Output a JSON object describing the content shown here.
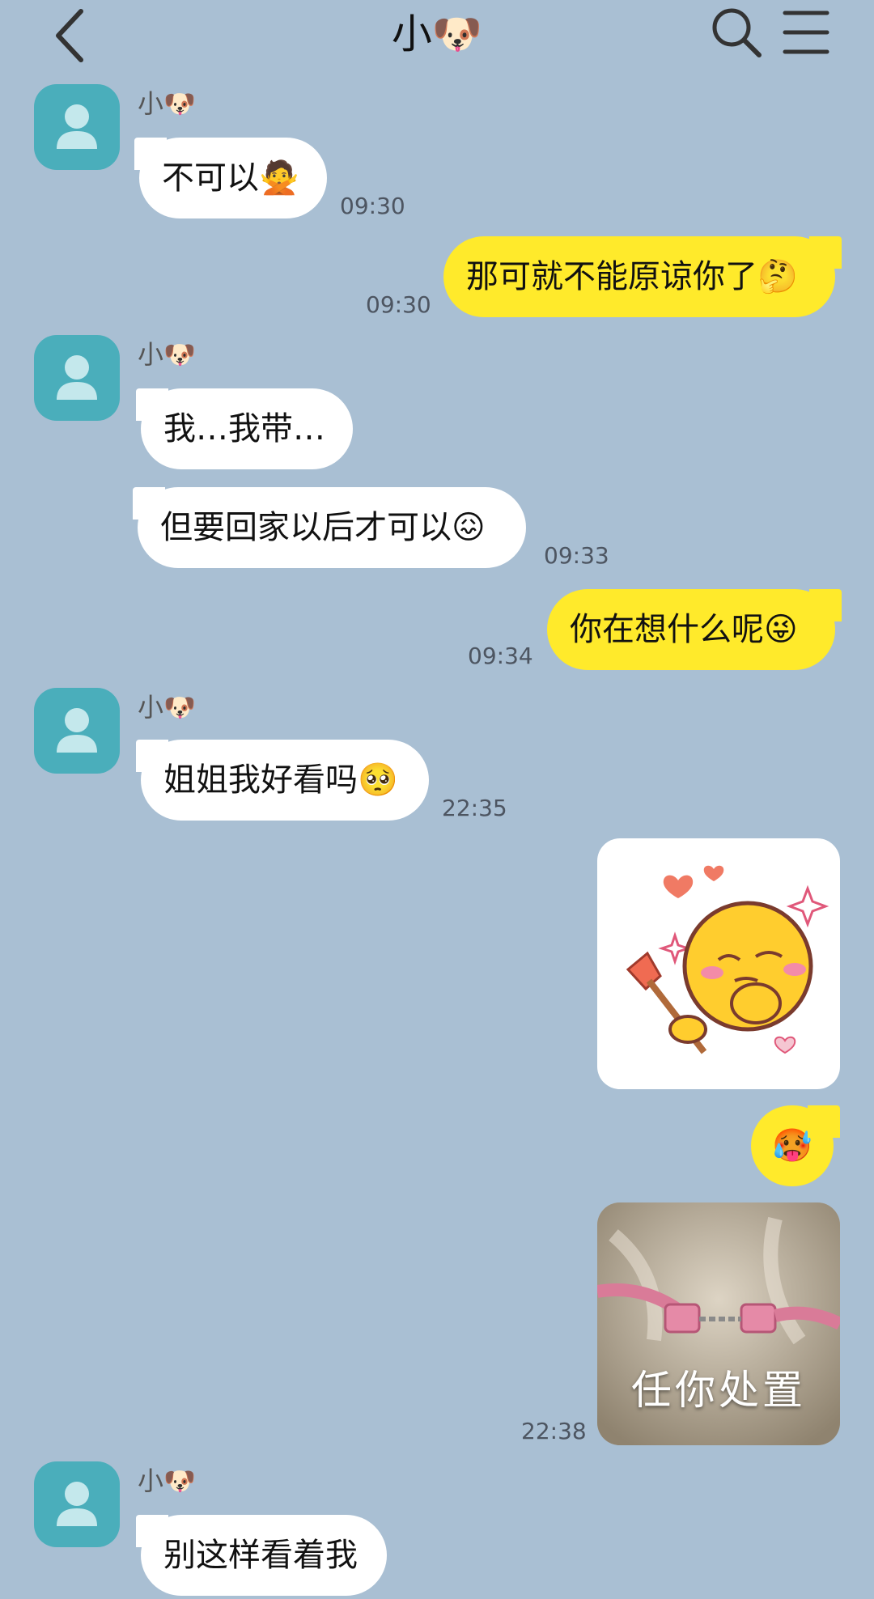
{
  "header": {
    "title": "小🐶"
  },
  "messages": [
    {
      "sender": "小🐶",
      "text": "不可以🙅",
      "time": "09:30"
    },
    {
      "text": "那可就不能原谅你了🤔",
      "time": "09:30"
    },
    {
      "sender": "小🐶",
      "text": "我…我带…"
    },
    {
      "text": "但要回家以后才可以😖",
      "time": "09:33"
    },
    {
      "text": "你在想什么呢😜",
      "time": "09:34"
    },
    {
      "sender": "小🐶",
      "text": "姐姐我好看吗🥺",
      "time": "22:35"
    },
    {
      "text": "🥵"
    },
    {
      "caption": "任你处置",
      "time": "22:38"
    },
    {
      "sender": "小🐶",
      "text": "别这样看着我"
    }
  ],
  "colors": {
    "background": "#a9bfd3",
    "incoming": "#ffffff",
    "outgoing": "#ffea2b",
    "avatar": "#4aaebb"
  }
}
